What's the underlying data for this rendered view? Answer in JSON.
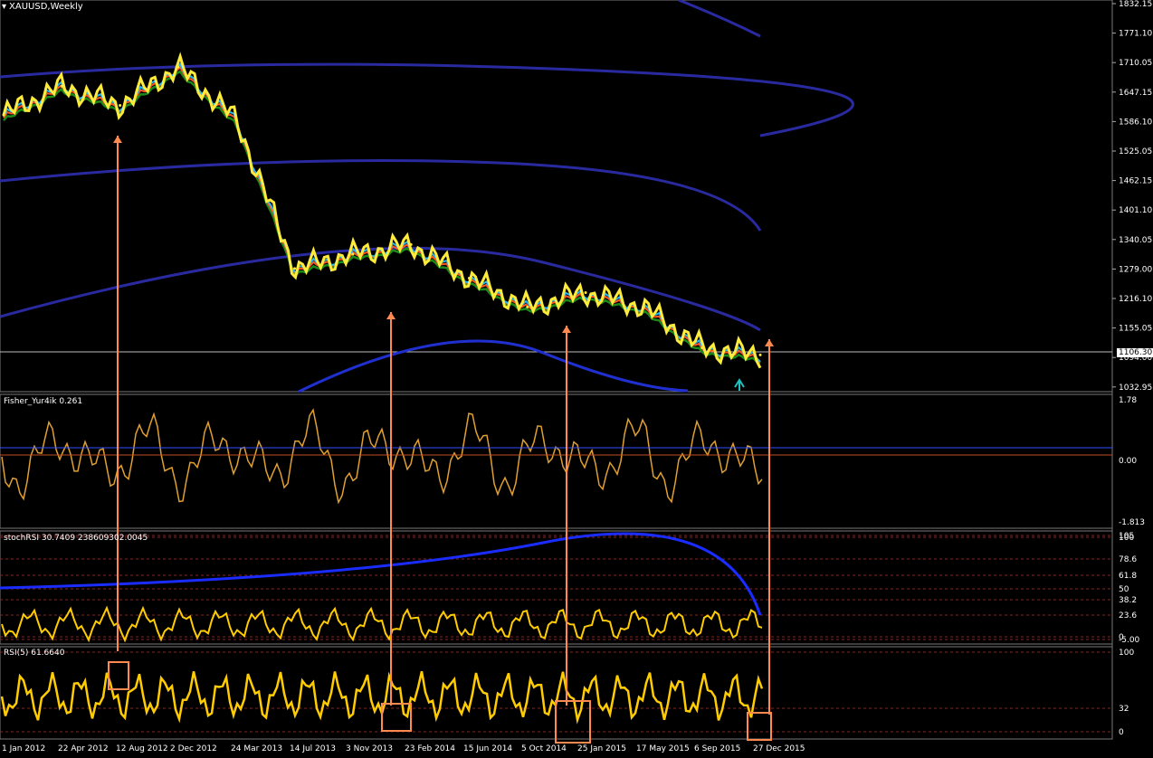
{
  "window": {
    "title": "XAUUSD,Weekly"
  },
  "colors": {
    "background": "#000000",
    "price": "#ffeb3b",
    "ema_fast": "#29b6f6",
    "ema_slow": "#ff5722",
    "ma_long": "#1b8a1b",
    "envelope": "#2a2aa0",
    "arrow": "#ff8a50",
    "rsi_line": "#ffcc00",
    "grid": "#7a2a2a"
  },
  "panels": {
    "main": {
      "price_labels": [
        "1832.15",
        "1771.10",
        "1710.05",
        "1647.15",
        "1586.10",
        "1525.05",
        "1462.15",
        "1401.10",
        "1340.05",
        "1279.00",
        "1216.10",
        "1155.05",
        "1094.00",
        "1032.95"
      ],
      "current_price": "1106.30"
    },
    "fisher": {
      "label": "Fisher_Yur4ik 0.261",
      "scale": [
        "1.78",
        "0.00",
        "-1.813"
      ]
    },
    "stochrsi": {
      "label": "stochRSI 30.7409 238609302.0045",
      "scale": [
        "105",
        "100",
        "78.6",
        "61.8",
        "50",
        "38.2",
        "23.6",
        "0",
        "-5.00"
      ]
    },
    "rsi": {
      "label": "RSI(5) 61.6640",
      "scale": [
        "100",
        "32",
        "0"
      ]
    }
  },
  "x_axis": {
    "dates": [
      "1 Jan 2012",
      "22 Apr 2012",
      "12 Aug 2012",
      "2 Dec 2012",
      "24 Mar 2013",
      "14 Jul 2013",
      "3 Nov 2013",
      "23 Feb 2014",
      "15 Jun 2014",
      "5 Oct 2014",
      "25 Jan 2015",
      "17 May 2015",
      "6 Sep 2015",
      "27 Dec 2015"
    ]
  },
  "chart_data": {
    "type": "line",
    "x": [
      "1 Jan 2012",
      "22 Apr 2012",
      "12 Aug 2012",
      "2 Dec 2012",
      "24 Mar 2013",
      "14 Jul 2013",
      "3 Nov 2013",
      "23 Feb 2014",
      "15 Jun 2014",
      "5 Oct 2014",
      "25 Jan 2015",
      "17 May 2015",
      "6 Sep 2015",
      "27 Dec 2015"
    ],
    "series": [
      {
        "values": [
          1600,
          1660,
          1620,
          1700,
          1590,
          1280,
          1310,
          1330,
          1260,
          1200,
          1230,
          1200,
          1115,
          1100
        ]
      }
    ],
    "ylim": [
      1032.95,
      1832.15
    ]
  }
}
